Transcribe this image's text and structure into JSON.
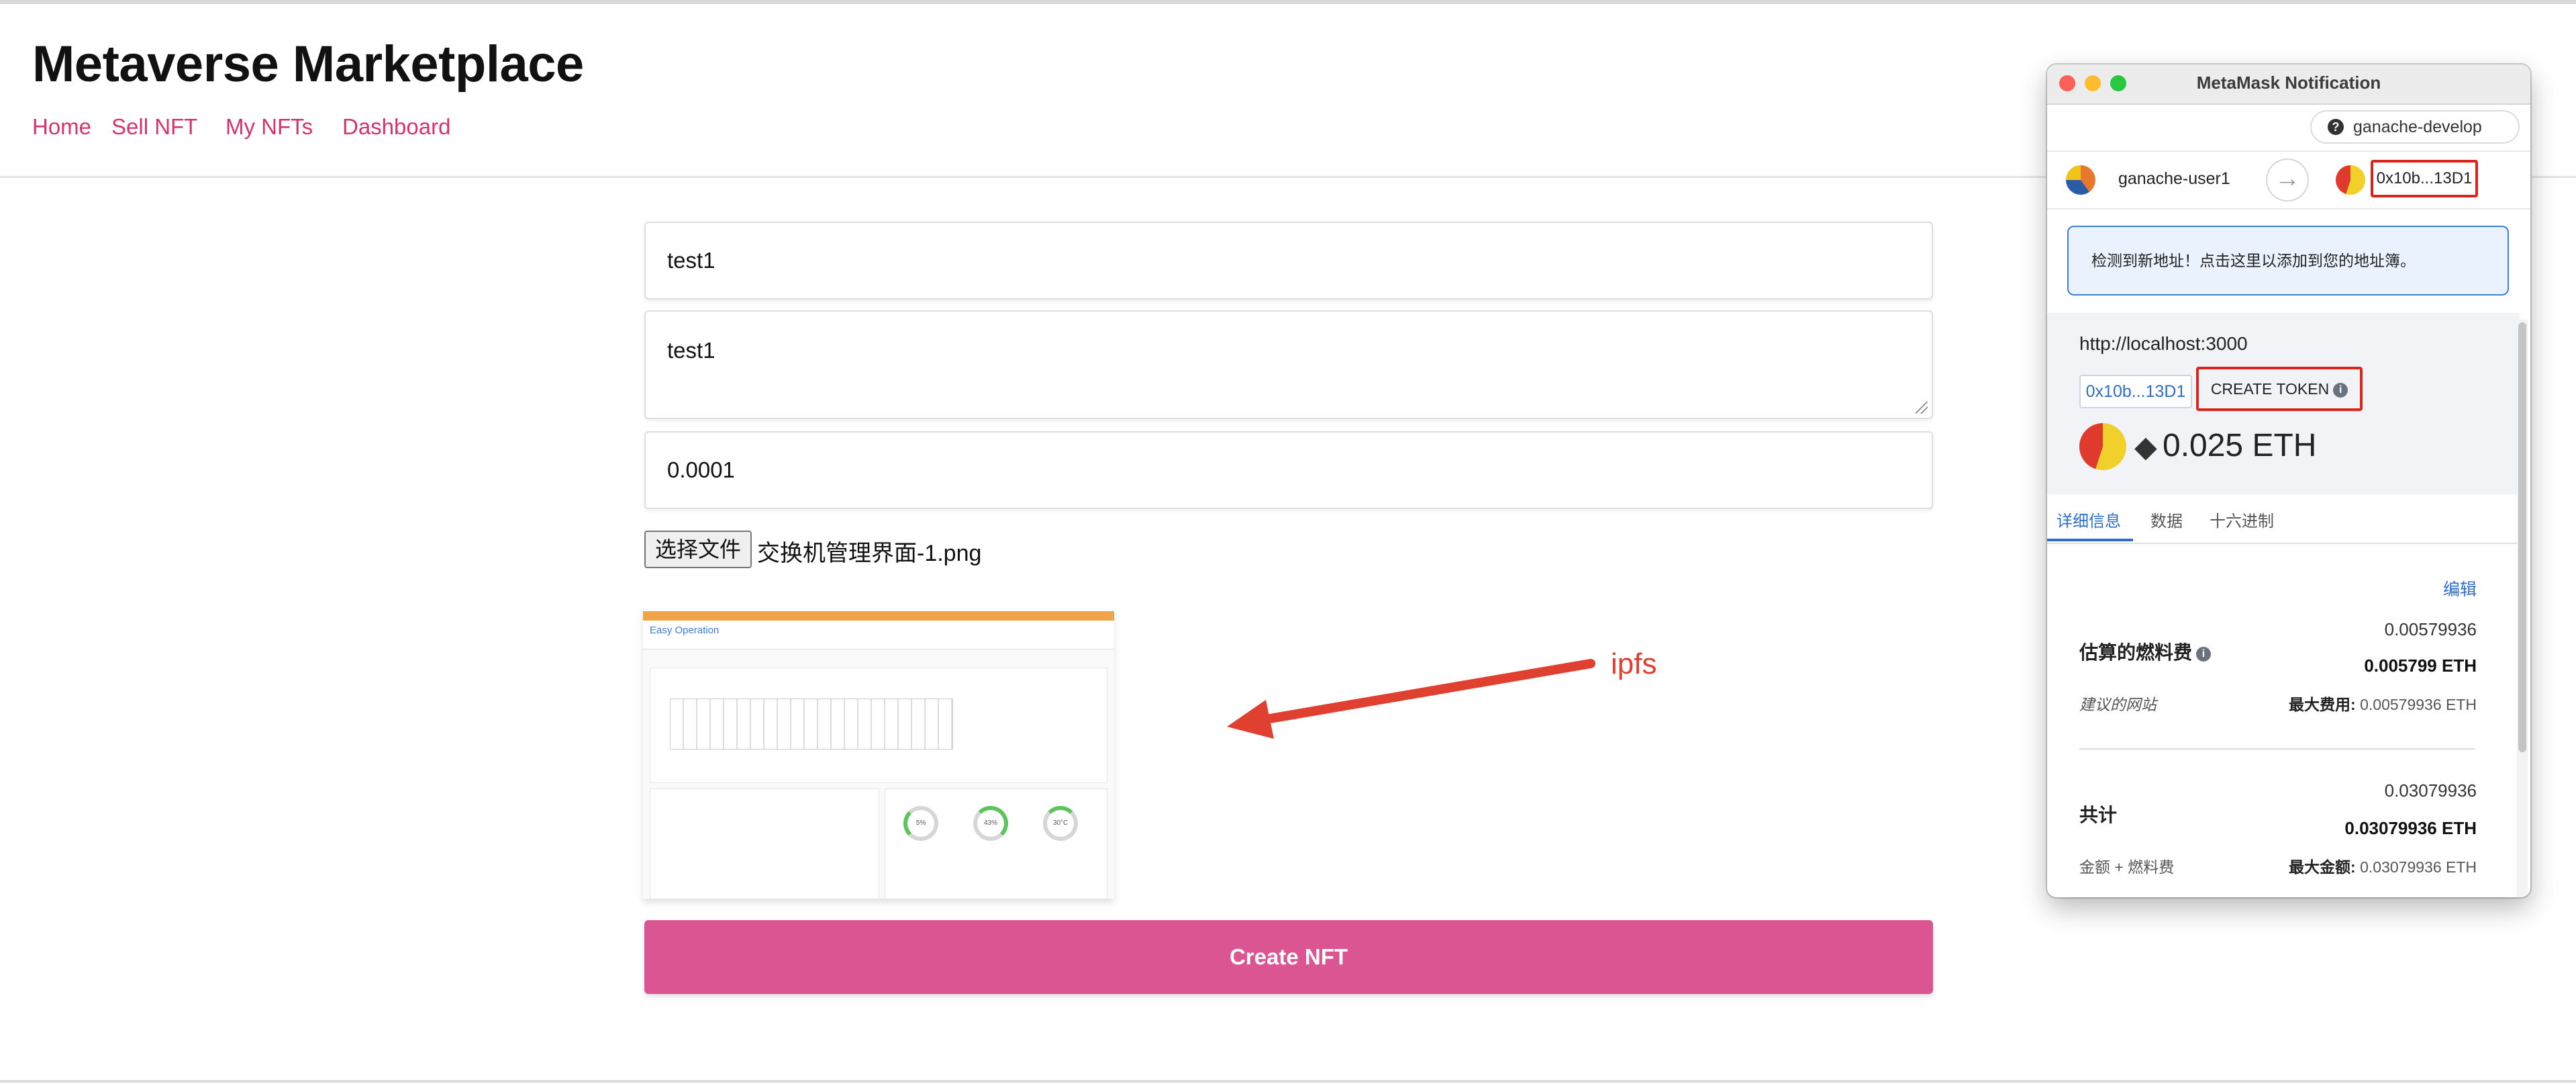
{
  "site": {
    "title": "Metaverse Marketplace",
    "nav": [
      "Home",
      "Sell NFT",
      "My NFTs",
      "Dashboard"
    ]
  },
  "form": {
    "name_value": "test1",
    "description_value": "test1",
    "price_value": "0.0001",
    "file_button_label": "选择文件",
    "file_name": "交换机管理界面-1.png",
    "preview_brand": "Easy Operation",
    "preview_gauges": [
      "5%",
      "43%",
      "30°C"
    ],
    "submit_label": "Create NFT"
  },
  "annotation": {
    "label": "ipfs",
    "color": "#e0402f"
  },
  "metamask": {
    "window_title": "MetaMask Notification",
    "network": "ganache-develop",
    "from_account": "ganache-user1",
    "to_address": "0x10b...13D1",
    "notice": "检测到新地址！点击这里以添加到您的地址簿。",
    "origin": "http://localhost:3000",
    "recipient_chip": "0x10b...13D1",
    "method": "CREATE TOKEN",
    "amount": "0.025 ETH",
    "tabs": [
      "详细信息",
      "数据",
      "十六进制"
    ],
    "active_tab": "详细信息",
    "edit_label": "编辑",
    "gas": {
      "label": "估算的燃料费",
      "value": "0.00579936",
      "value_eth": "0.005799 ETH",
      "site_suggestion": "建议的网站",
      "max_fee_label": "最大费用:",
      "max_fee_value": "0.00579936 ETH"
    },
    "total": {
      "label": "共计",
      "value": "0.03079936",
      "value_eth": "0.03079936 ETH",
      "sub_label": "金额 + 燃料费",
      "max_amount_label": "最大金额:",
      "max_amount_value": "0.03079936 ETH"
    },
    "accent_color": "#2d6fc8",
    "highlight_color": "#d8261c"
  },
  "colors": {
    "nav_link": "#d6336c",
    "create_button": "#db5592"
  }
}
